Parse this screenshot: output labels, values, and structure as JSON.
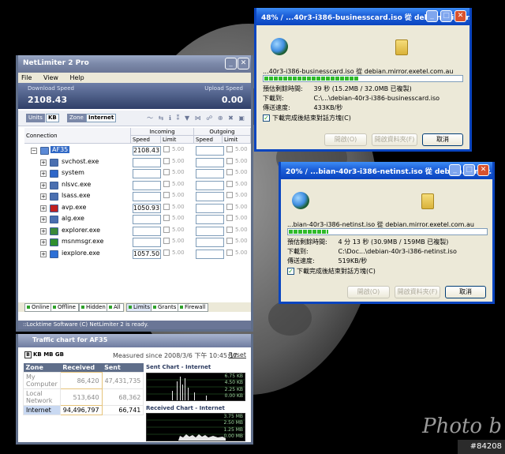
{
  "dialog1": {
    "title": "48% / ...40r3-i386-businesscard.iso 從 debian.mirror.exetel.com.au",
    "file_line": "...40r3-i386-businesscard.iso 從 debian.mirror.exetel.com.au",
    "progress": 0.48,
    "est_label": "預估剩餘時間:",
    "est_value": "39 秒 (15.2MB / 32.0MB 已複製)",
    "dest_label": "下載到:",
    "dest_value": "C:\\...\\debian-40r3-i386-businesscard.iso",
    "rate_label": "傳送速度:",
    "rate_value": "433KB/秒",
    "close_label": "下載完成後結束對話方塊(C)",
    "open_label": "開啟(O)",
    "open_folder_label": "開啟資料夾(F)",
    "cancel_label": "取消"
  },
  "dialog2": {
    "title": "20% / ...bian-40r3-i386-netinst.iso 從 debian.mirror...",
    "file_line": "...bian-40r3-i386-netinst.iso 從 debian.mirror.exetel.com.au",
    "progress": 0.2,
    "est_label": "預估剩餘時間:",
    "est_value": "4 分 13 秒 (30.9MB / 159MB 已複製)",
    "dest_label": "下載到:",
    "dest_value": "C:\\Doc...\\debian-40r3-i386-netinst.iso",
    "rate_label": "傳送速度:",
    "rate_value": "519KB/秒",
    "close_label": "下載完成後結束對話方塊(C)",
    "open_label": "開啟(O)",
    "open_folder_label": "開啟資料夾(F)",
    "cancel_label": "取消"
  },
  "netlimiter": {
    "title": "NetLimiter 2 Pro",
    "menu": [
      "File",
      "View",
      "Help"
    ],
    "download_label": "Download Speed",
    "download_value": "2108.43",
    "upload_label": "Upload Speed",
    "upload_value": "0.00",
    "units_label": "Units",
    "units_value": "KB",
    "zone_label": "Zone",
    "zone_value": "Internet",
    "col_connection": "Connection",
    "col_incoming": "Incoming",
    "col_outgoing": "Outgoing",
    "col_speed": "Speed",
    "col_limit": "Limit",
    "limit_value": "5.00",
    "rows": [
      {
        "name": "AF35",
        "speed": "2108.43",
        "selected": true
      },
      {
        "name": "svchost.exe",
        "speed": ""
      },
      {
        "name": "system",
        "speed": ""
      },
      {
        "name": "nlsvc.exe",
        "speed": ""
      },
      {
        "name": "lsass.exe",
        "speed": ""
      },
      {
        "name": "avp.exe",
        "speed": "1050.93"
      },
      {
        "name": "alg.exe",
        "speed": ""
      },
      {
        "name": "explorer.exe",
        "speed": ""
      },
      {
        "name": "msnmsgr.exe",
        "speed": ""
      },
      {
        "name": "iexplore.exe",
        "speed": "1057.50"
      }
    ],
    "tabs": [
      "Online",
      "Offline",
      "Hidden",
      "All",
      "Limits",
      "Grants",
      "Firewall"
    ],
    "status": "::Locktime Software (C) NetLimiter 2 is ready."
  },
  "traffic": {
    "title": "Traffic chart for AF35",
    "units": "KB MB GB",
    "measured": "Measured since 2008/3/6 下午 10:45:17",
    "reset": "Reset",
    "headers": [
      "Zone",
      "Received",
      "Sent"
    ],
    "zones": [
      {
        "zone": "My Computer",
        "received": "86,420",
        "sent": "47,431,735"
      },
      {
        "zone": "Local Network",
        "received": "513,640",
        "sent": "68,362"
      },
      {
        "zone": "Internet",
        "received": "94,496,797",
        "sent": "66,741"
      }
    ],
    "sent_title": "Sent Chart - Internet",
    "sent_ticks": [
      "6.75 KB",
      "4.50 KB",
      "2.25 KB",
      "0.00 KB"
    ],
    "recv_title": "Received Chart - Internet",
    "recv_ticks": [
      "3.75 MB",
      "2.50 MB",
      "1.25 MB",
      "0.00 MB"
    ]
  },
  "desktop": {
    "watermark": "Photo b",
    "badge": "#84208"
  }
}
